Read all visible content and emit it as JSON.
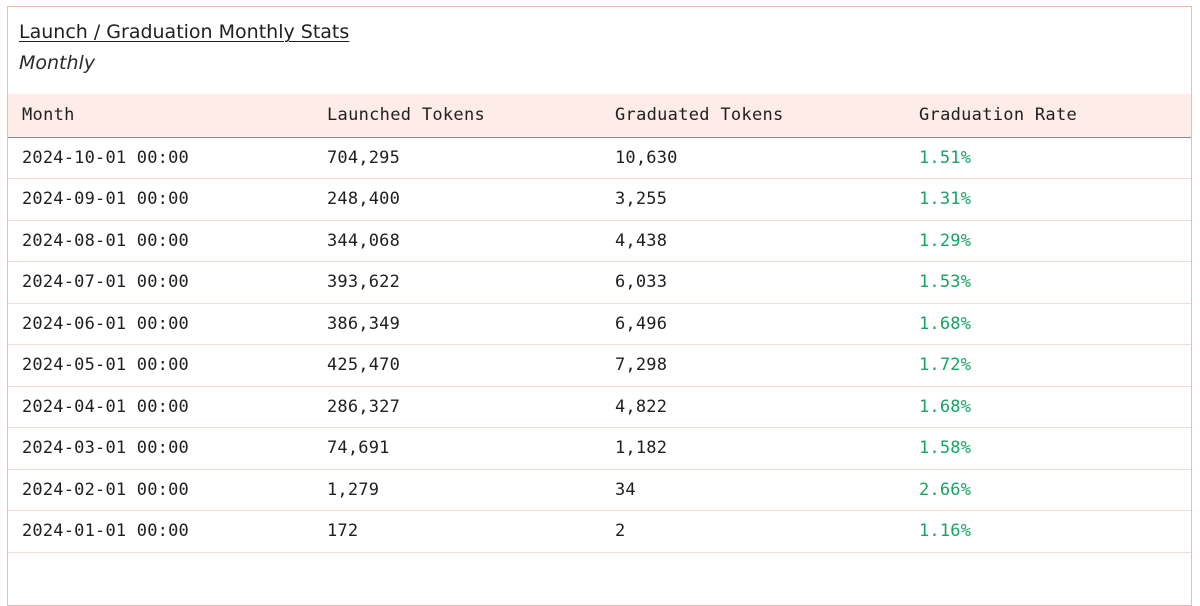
{
  "widget": {
    "title": "Launch / Graduation Monthly Stats",
    "subtitle": "Monthly"
  },
  "table": {
    "columns": [
      "Month",
      "Launched Tokens",
      "Graduated Tokens",
      "Graduation Rate"
    ],
    "rows": [
      [
        "2024-10-01 00:00",
        "704,295",
        "10,630",
        "1.51%"
      ],
      [
        "2024-09-01 00:00",
        "248,400",
        "3,255",
        "1.31%"
      ],
      [
        "2024-08-01 00:00",
        "344,068",
        "4,438",
        "1.29%"
      ],
      [
        "2024-07-01 00:00",
        "393,622",
        "6,033",
        "1.53%"
      ],
      [
        "2024-06-01 00:00",
        "386,349",
        "6,496",
        "1.68%"
      ],
      [
        "2024-05-01 00:00",
        "425,470",
        "7,298",
        "1.72%"
      ],
      [
        "2024-04-01 00:00",
        "286,327",
        "4,822",
        "1.68%"
      ],
      [
        "2024-03-01 00:00",
        "74,691",
        "1,182",
        "1.58%"
      ],
      [
        "2024-02-01 00:00",
        "1,279",
        "34",
        "2.66%"
      ],
      [
        "2024-01-01 00:00",
        "172",
        "2",
        "1.16%"
      ]
    ]
  },
  "colors": {
    "border": "#f0b9a8",
    "header_bg": "#fdece7",
    "rate_text": "#16a364",
    "row_divider": "#f6dcd4"
  }
}
